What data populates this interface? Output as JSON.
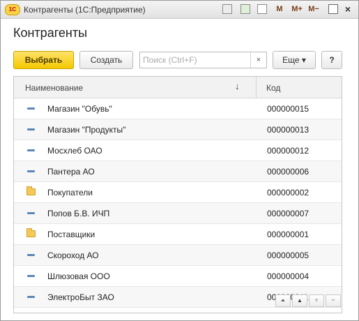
{
  "window": {
    "title": "Контрагенты  (1С:Предприятие)",
    "logo": "1С",
    "toolbar": {
      "m": "M",
      "m_plus": "M+",
      "m_minus": "M−"
    }
  },
  "page": {
    "heading": "Контрагенты"
  },
  "actions": {
    "select_label": "Выбрать",
    "create_label": "Создать",
    "search_placeholder": "Поиск (Ctrl+F)",
    "search_clear": "×",
    "more_label": "Еще ▾",
    "help_label": "?"
  },
  "table": {
    "columns": {
      "name": "Наименование",
      "code": "Код"
    },
    "sort_indicator": "↓",
    "rows": [
      {
        "name": "Магазин \"Обувь\"",
        "code": "000000015",
        "icon": "item-icon"
      },
      {
        "name": "Магазин \"Продукты\"",
        "code": "000000013",
        "icon": "item-icon"
      },
      {
        "name": "Мосхлеб ОАО",
        "code": "000000012",
        "icon": "item-icon"
      },
      {
        "name": "Пантера АО",
        "code": "000000006",
        "icon": "item-icon"
      },
      {
        "name": "Покупатели",
        "code": "000000002",
        "icon": "folder-icon"
      },
      {
        "name": "Попов Б.В. ИЧП",
        "code": "000000007",
        "icon": "item-icon"
      },
      {
        "name": "Поставщики",
        "code": "000000001",
        "icon": "folder-icon"
      },
      {
        "name": "Скороход АО",
        "code": "000000005",
        "icon": "item-icon"
      },
      {
        "name": "Шлюзовая ООО",
        "code": "000000004",
        "icon": "item-icon"
      },
      {
        "name": "ЭлектроБыт ЗАО",
        "code": "000000011",
        "icon": "item-icon"
      }
    ]
  },
  "colors": {
    "accent": "#f5c800",
    "item_icon": "#5a86b8",
    "folder_icon": "#f4c955"
  }
}
